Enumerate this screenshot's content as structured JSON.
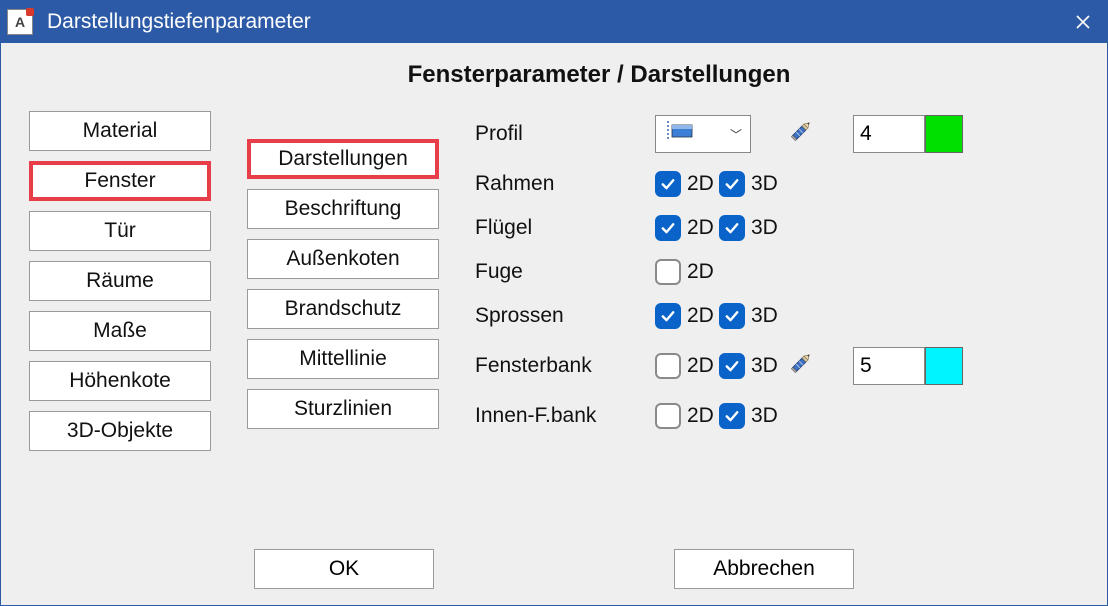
{
  "window": {
    "title": "Darstellungstiefenparameter",
    "app_icon_letter": "A"
  },
  "heading": "Fensterparameter / Darstellungen",
  "left_tabs": [
    {
      "label": "Material",
      "selected": false
    },
    {
      "label": "Fenster",
      "selected": true
    },
    {
      "label": "Tür",
      "selected": false
    },
    {
      "label": "Räume",
      "selected": false
    },
    {
      "label": "Maße",
      "selected": false
    },
    {
      "label": "Höhenkote",
      "selected": false
    },
    {
      "label": "3D-Objekte",
      "selected": false
    }
  ],
  "mid_tabs": [
    {
      "label": "Darstellungen",
      "selected": true
    },
    {
      "label": "Beschriftung",
      "selected": false
    },
    {
      "label": "Außenkoten",
      "selected": false
    },
    {
      "label": "Brandschutz",
      "selected": false
    },
    {
      "label": "Mittellinie",
      "selected": false
    },
    {
      "label": "Sturzlinien",
      "selected": false
    }
  ],
  "params": {
    "profil": {
      "label": "Profil",
      "type": "dropdown",
      "edit": true,
      "value": "4",
      "color": "#00e000"
    },
    "rahmen": {
      "label": "Rahmen",
      "d2": true,
      "d3": true
    },
    "fluegel": {
      "label": "Flügel",
      "d2": true,
      "d3": true
    },
    "fuge": {
      "label": "Fuge",
      "d2": false,
      "d3": null
    },
    "sprossen": {
      "label": "Sprossen",
      "d2": true,
      "d3": true
    },
    "fensterbank": {
      "label": "Fensterbank",
      "d2": false,
      "d3": true,
      "edit": true,
      "value": "5",
      "color": "#00f4ff"
    },
    "innenfbank": {
      "label": "Innen-F.bank",
      "d2": false,
      "d3": true
    }
  },
  "labels": {
    "d2": "2D",
    "d3": "3D"
  },
  "footer": {
    "ok": "OK",
    "cancel": "Abbrechen"
  }
}
